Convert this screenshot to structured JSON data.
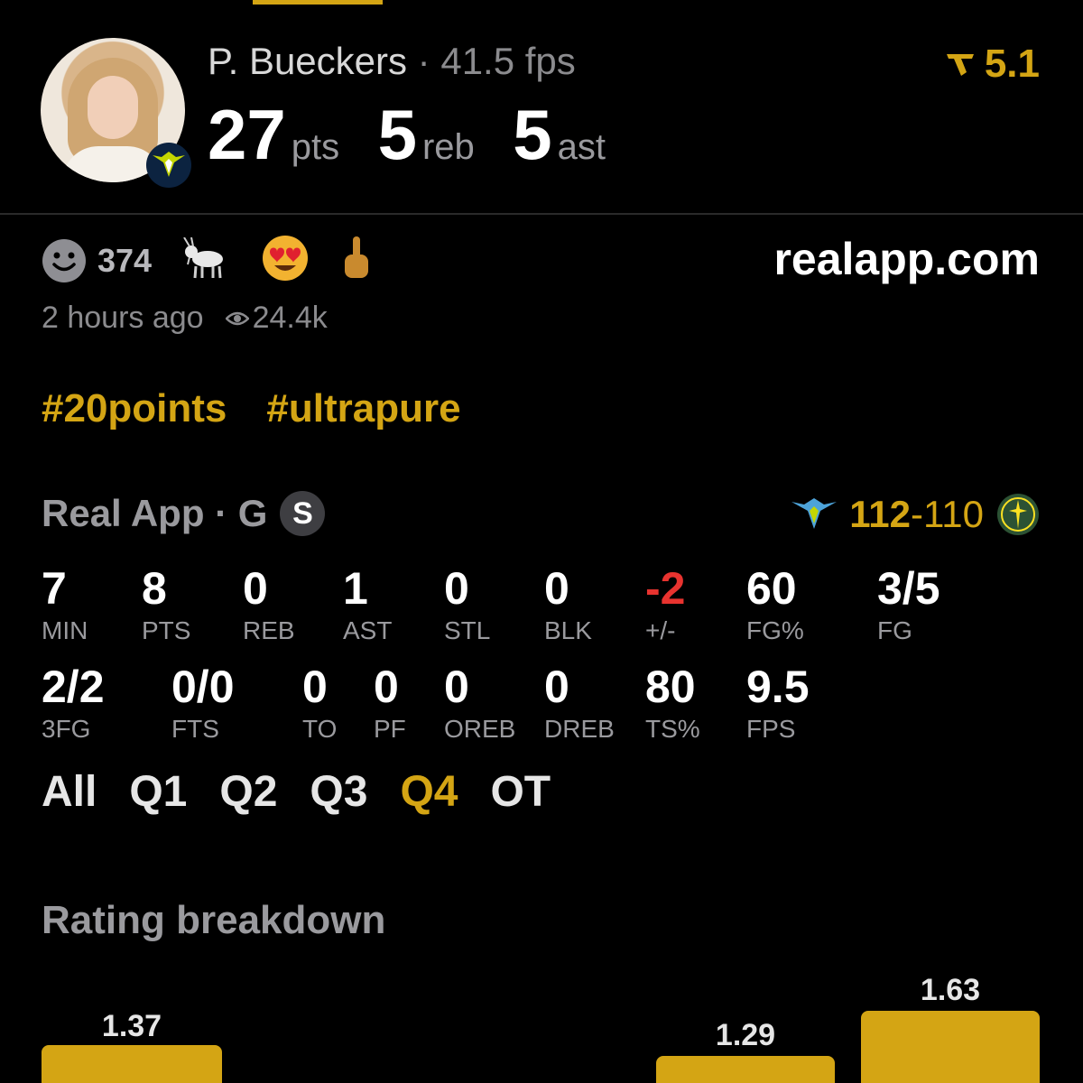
{
  "header": {
    "player_name": "P. Bueckers",
    "separator": " · ",
    "fps": "41.5 fps",
    "rating": "5.1",
    "rating_icon": "real-logo-icon",
    "stats": [
      {
        "value": "27",
        "unit": "pts"
      },
      {
        "value": "5",
        "unit": "reb"
      },
      {
        "value": "5",
        "unit": "ast"
      }
    ]
  },
  "reactions": {
    "count": "374",
    "site": "realapp.com",
    "time_ago": "2 hours ago",
    "views": "24.4k",
    "emojis": [
      "smiley-icon",
      "goat-icon",
      "heart-eyes-icon",
      "middle-finger-icon"
    ]
  },
  "tags": [
    "#20points",
    "#ultrapure"
  ],
  "game": {
    "title": "Real App · G",
    "badge": "S",
    "home_score": "112",
    "dash": "-",
    "away_score": "110"
  },
  "box_score": {
    "row1": [
      {
        "value": "7",
        "label": "MIN"
      },
      {
        "value": "8",
        "label": "PTS"
      },
      {
        "value": "0",
        "label": "REB"
      },
      {
        "value": "1",
        "label": "AST"
      },
      {
        "value": "0",
        "label": "STL"
      },
      {
        "value": "0",
        "label": "BLK"
      },
      {
        "value": "-2",
        "label": "+/-"
      },
      {
        "value": "60",
        "label": "FG%"
      },
      {
        "value": "3/5",
        "label": "FG"
      }
    ],
    "row2": [
      {
        "value": "2/2",
        "label": "3FG"
      },
      {
        "value": "0/0",
        "label": "FTS"
      },
      {
        "value": "0",
        "label": "TO"
      },
      {
        "value": "0",
        "label": "PF"
      },
      {
        "value": "0",
        "label": "OREB"
      },
      {
        "value": "0",
        "label": "DREB"
      },
      {
        "value": "80",
        "label": "TS%"
      },
      {
        "value": "9.5",
        "label": "FPS"
      }
    ]
  },
  "quarters": [
    "All",
    "Q1",
    "Q2",
    "Q3",
    "Q4",
    "OT"
  ],
  "active_quarter": "Q4",
  "rating_breakdown": {
    "title": "Rating breakdown",
    "bars": [
      {
        "value": "1.37"
      },
      {
        "value": "1.29"
      },
      {
        "value": "1.63"
      }
    ]
  },
  "colors": {
    "accent": "#d4a514",
    "negative": "#e8332f",
    "background": "#000000"
  }
}
